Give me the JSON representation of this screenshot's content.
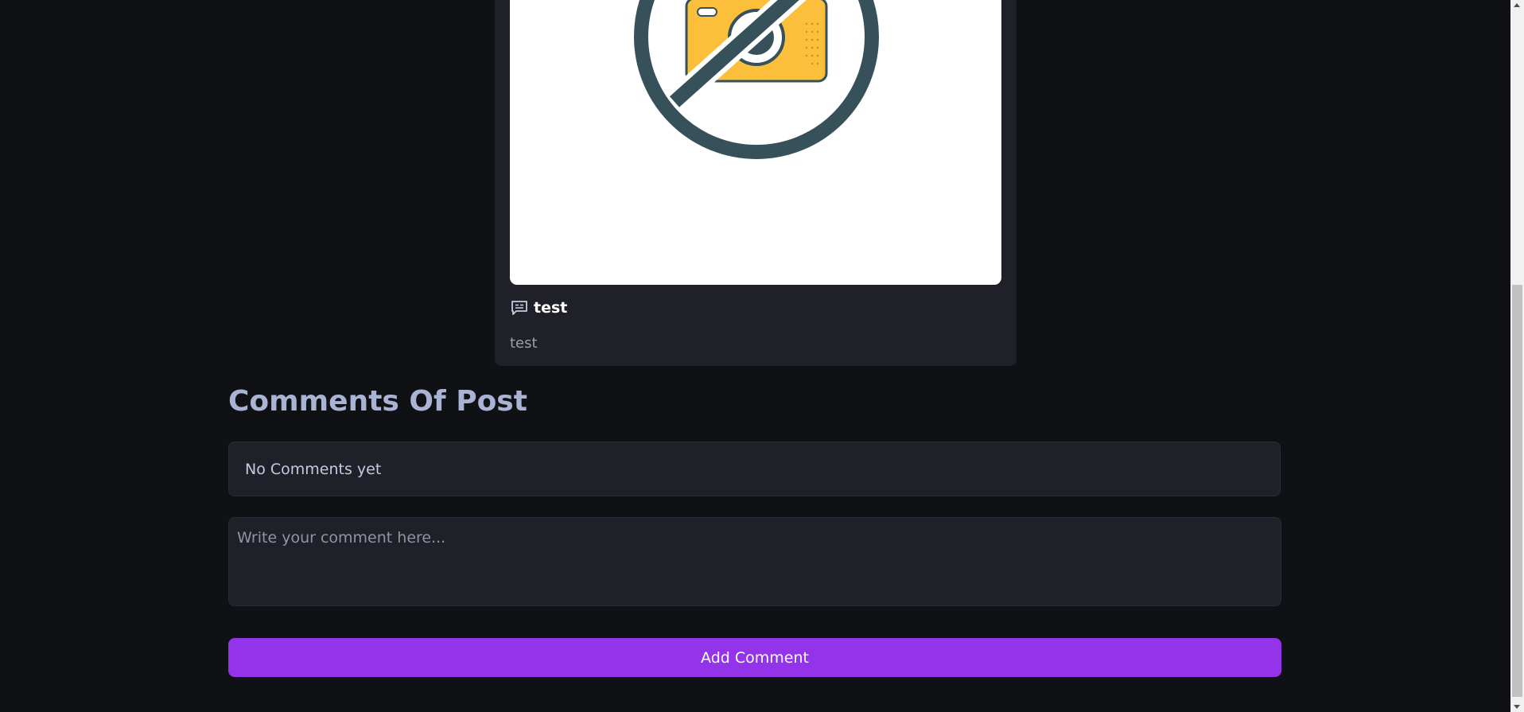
{
  "post": {
    "image_icon": "no-camera-icon",
    "title_icon": "chat-message-icon",
    "title": "test",
    "body": "test"
  },
  "comments": {
    "heading": "Comments Of Post",
    "empty_text": "No Comments yet",
    "input_placeholder": "Write your comment here...",
    "add_button_label": "Add Comment"
  },
  "colors": {
    "background": "#0f1115",
    "card": "#1f2028",
    "heading": "#a9b4d4",
    "accent": "#9333ea",
    "camera_body": "#fbbf3c",
    "icon_stroke": "#37515a"
  }
}
